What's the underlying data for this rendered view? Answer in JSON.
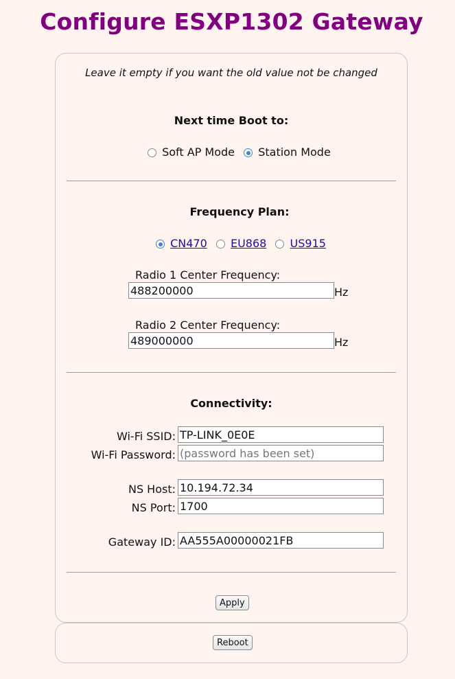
{
  "page": {
    "title": "Configure ESXP1302 Gateway"
  },
  "form": {
    "note": "Leave it empty if you want the old value not be changed",
    "boot": {
      "heading": "Next time Boot to:",
      "options": [
        {
          "label": "Soft AP Mode",
          "selected": false
        },
        {
          "label": "Station Mode",
          "selected": true
        }
      ]
    },
    "frequency": {
      "heading": "Frequency Plan:",
      "plans": [
        {
          "label": "CN470",
          "selected": true
        },
        {
          "label": "EU868",
          "selected": false
        },
        {
          "label": "US915",
          "selected": false
        }
      ],
      "radio1": {
        "label": "Radio 1 Center Frequency:",
        "value": "488200000",
        "unit": "Hz"
      },
      "radio2": {
        "label": "Radio 2 Center Frequency:",
        "value": "489000000",
        "unit": "Hz"
      }
    },
    "connectivity": {
      "heading": "Connectivity:",
      "wifi_ssid": {
        "label": "Wi-Fi SSID:",
        "value": "TP-LINK_0E0E"
      },
      "wifi_password": {
        "label": "Wi-Fi Password:",
        "value": "",
        "placeholder": "(password has been set)"
      },
      "ns_host": {
        "label": "NS Host:",
        "value": "10.194.72.34"
      },
      "ns_port": {
        "label": "NS Port:",
        "value": "1700"
      },
      "gateway_id": {
        "label": "Gateway ID:",
        "value": "AA555A00000021FB"
      }
    },
    "apply_label": "Apply"
  },
  "reboot": {
    "label": "Reboot"
  },
  "colors": {
    "title": "#800080",
    "background": "#fff4ef",
    "accent": "#3b82d8",
    "link": "#1a0dab"
  }
}
